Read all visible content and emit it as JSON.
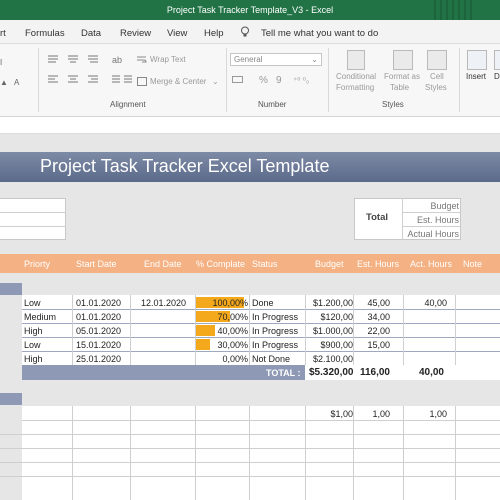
{
  "window": {
    "title": "Project Task Tracker Template_V3  -  Excel"
  },
  "menu": {
    "items": [
      "rt",
      "Formulas",
      "Data",
      "Review",
      "View",
      "Help"
    ],
    "tell_me": "Tell me what you want to do"
  },
  "ribbon": {
    "wrap_text": "Wrap Text",
    "merge_center": "Merge & Center",
    "number_format": "General",
    "percent": "%",
    "comma": "9",
    "conditional_formatting_1": "Conditional",
    "conditional_formatting_2": "Formatting",
    "format_as_table_1": "Format as",
    "format_as_table_2": "Table",
    "cell_styles_1": "Cell",
    "cell_styles_2": "Styles",
    "insert": "Insert",
    "delete": "D",
    "groups": {
      "alignment": "Alignment",
      "number": "Number",
      "styles": "Styles"
    }
  },
  "sheet": {
    "title": "Project Task Tracker Excel Template",
    "summary": {
      "total_label": "Total",
      "labels": [
        "Budget",
        "Est. Hours",
        "Actual Hours"
      ]
    },
    "columns": [
      "Priorty",
      "Start Date",
      "End Date",
      "% Complate",
      "Status",
      "Budget",
      "Est. Hours",
      "Act. Hours",
      "Note"
    ],
    "rows": [
      {
        "priority": "Low",
        "start": "01.01.2020",
        "end": "12.01.2020",
        "complete": "100,00%",
        "complete_value": 1.0,
        "status": "Done",
        "budget": "$1.200,00",
        "est": "45,00",
        "act": "40,00"
      },
      {
        "priority": "Medium",
        "start": "01.01.2020",
        "end": "",
        "complete": "70,00%",
        "complete_value": 0.7,
        "status": "In Progress",
        "budget": "$120,00",
        "est": "34,00",
        "act": ""
      },
      {
        "priority": "High",
        "start": "05.01.2020",
        "end": "",
        "complete": "40,00%",
        "complete_value": 0.4,
        "status": "In Progress",
        "budget": "$1.000,00",
        "est": "22,00",
        "act": ""
      },
      {
        "priority": "Low",
        "start": "15.01.2020",
        "end": "",
        "complete": "30,00%",
        "complete_value": 0.3,
        "status": "In Progress",
        "budget": "$900,00",
        "est": "15,00",
        "act": ""
      },
      {
        "priority": "High",
        "start": "25.01.2020",
        "end": "",
        "complete": "0,00%",
        "complete_value": 0.0,
        "status": "Not Done",
        "budget": "$2.100,00",
        "est": "",
        "act": ""
      }
    ],
    "total": {
      "label": "TOTAL :",
      "budget": "$5.320,00",
      "est": "116,00",
      "act": "40,00"
    },
    "second": {
      "budget": "$1,00",
      "est": "1,00",
      "act": "1,00"
    }
  },
  "colors": {
    "excel_green": "#217346",
    "header_orange": "#f4b183",
    "bar_orange": "#f4a81c",
    "banner_slate": "#5b6a8a"
  }
}
